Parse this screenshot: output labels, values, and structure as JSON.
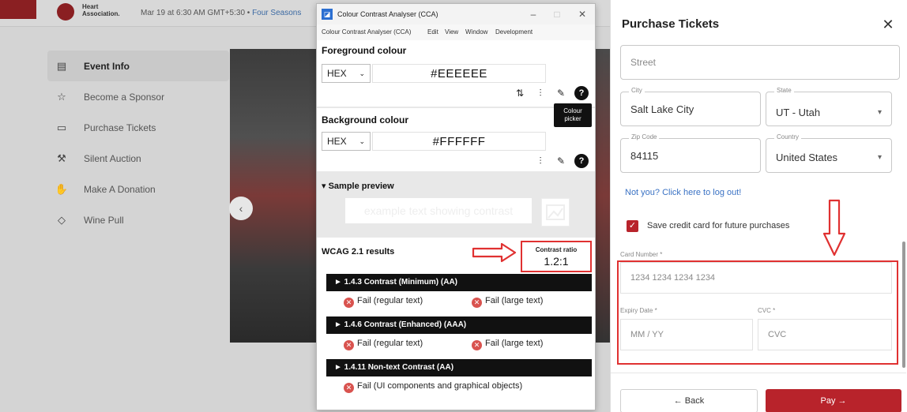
{
  "background_page": {
    "org_name_line1": "Heart",
    "org_name_line2": "Association.",
    "event_date": "Mar 19 at 6:30 AM GMT+5:30 •",
    "event_venue": "Four Seasons",
    "nav_items": [
      {
        "label": "Event Info",
        "icon": "info-card-icon",
        "glyph": "▤"
      },
      {
        "label": "Become a Sponsor",
        "icon": "star-icon",
        "glyph": "☆"
      },
      {
        "label": "Purchase Tickets",
        "icon": "ticket-icon",
        "glyph": "▭"
      },
      {
        "label": "Silent Auction",
        "icon": "gavel-icon",
        "glyph": "⚒"
      },
      {
        "label": "Make A Donation",
        "icon": "hand-heart-icon",
        "glyph": "✋"
      },
      {
        "label": "Wine Pull",
        "icon": "tag-icon",
        "glyph": "◇"
      }
    ],
    "carousel_prev_glyph": "‹"
  },
  "cca": {
    "window_title": "Colour Contrast Analyser (CCA)",
    "app_icon_glyph": "◪",
    "minimize_glyph": "–",
    "maximize_glyph": "□",
    "close_glyph": "✕",
    "menu": [
      "Colour Contrast Analyser (CCA)",
      "Edit",
      "View",
      "Window",
      "Development"
    ],
    "foreground": {
      "title": "Foreground colour",
      "format": "HEX",
      "value": "#EEEEEE",
      "tool_glyphs": [
        "⇅",
        "⫶",
        "✎",
        "?"
      ]
    },
    "background": {
      "title": "Background colour",
      "format": "HEX",
      "value": "#FFFFFF",
      "tool_glyphs": [
        "⫶",
        "✎",
        "?"
      ]
    },
    "picker_tooltip_line1": "Colour",
    "picker_tooltip_line2": "picker",
    "sample_preview": {
      "title": "▾ Sample preview",
      "text": "example text showing contrast"
    },
    "wcag": {
      "title": "WCAG 2.1 results",
      "ratio_label": "Contrast ratio",
      "ratio_value": "1.2:1",
      "criteria": [
        {
          "header": "► 1.4.3 Contrast (Minimum) (AA)",
          "results": [
            "Fail (regular text)",
            "Fail (large text)"
          ]
        },
        {
          "header": "► 1.4.6 Contrast (Enhanced) (AAA)",
          "results": [
            "Fail (regular text)",
            "Fail (large text)"
          ]
        },
        {
          "header": "► 1.4.11 Non-text Contrast (AA)",
          "results": [
            "Fail (UI components and graphical objects)"
          ]
        }
      ],
      "fail_glyph": "✕"
    },
    "colors": {
      "annotation_red": "#e03131",
      "fail_red": "#d9534f"
    }
  },
  "drawer": {
    "title": "Purchase Tickets",
    "close_glyph": "✕",
    "street": {
      "placeholder": "Street"
    },
    "city": {
      "label": "City",
      "value": "Salt Lake City"
    },
    "state": {
      "label": "State",
      "value": "UT - Utah",
      "chevron": "▾"
    },
    "zip": {
      "label": "Zip Code",
      "value": "84115"
    },
    "country": {
      "label": "Country",
      "value": "United States",
      "chevron": "▾"
    },
    "logout_link": "Not you? Click here to log out!",
    "save_card": {
      "checked": true,
      "check_glyph": "✓",
      "label": "Save credit card for future purchases"
    },
    "card_number": {
      "label": "Card Number *",
      "placeholder": "1234 1234 1234 1234"
    },
    "expiry": {
      "label": "Expiry Date *",
      "placeholder": "MM / YY"
    },
    "cvc": {
      "label": "CVC *",
      "placeholder": "CVC"
    },
    "back_label": "← Back",
    "pay_label": "Pay →",
    "colors": {
      "brand_red": "#b8232b",
      "link_blue": "#3a72c4"
    }
  }
}
